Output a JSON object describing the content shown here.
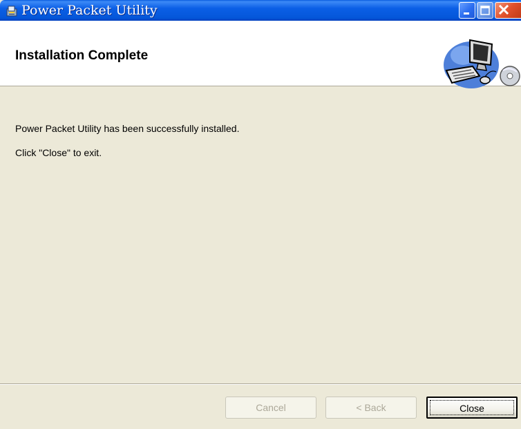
{
  "window": {
    "title": "Power Packet Utility"
  },
  "header": {
    "title": "Installation Complete"
  },
  "body": {
    "message": "Power Packet Utility has been successfully installed.",
    "instruction": "Click \"Close\" to exit."
  },
  "buttons": {
    "cancel": {
      "label": "Cancel",
      "enabled": false
    },
    "back": {
      "label": "< Back",
      "enabled": false
    },
    "close": {
      "label": "Close",
      "enabled": true,
      "focused": true
    }
  },
  "icons": {
    "title_icon": "installer-icon",
    "header_art": "computer-illustration"
  },
  "colors": {
    "titlebar": "#0456d8",
    "dialog_bg": "#ece9d8",
    "header_bg": "#ffffff",
    "close_button_red": "#e0512c"
  }
}
